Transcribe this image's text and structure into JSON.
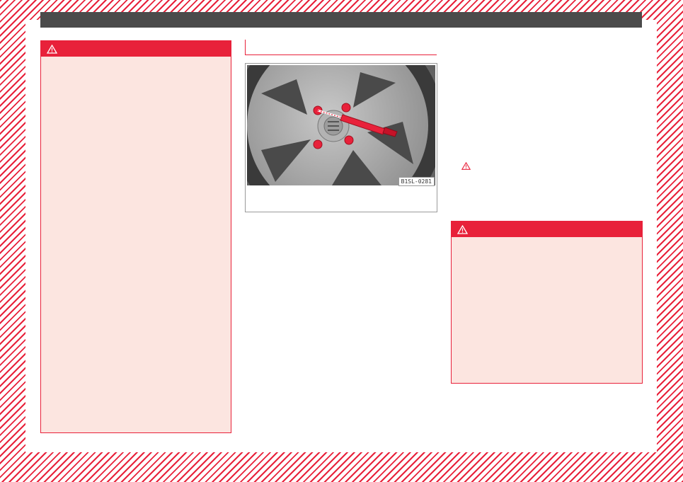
{
  "figure": {
    "code": "B1SL-0281"
  },
  "icons": {
    "warning": "warning-triangle-icon"
  },
  "colors": {
    "accent": "#e8213a",
    "warning_bg": "#fce5e0",
    "header": "#4b4b4b"
  }
}
